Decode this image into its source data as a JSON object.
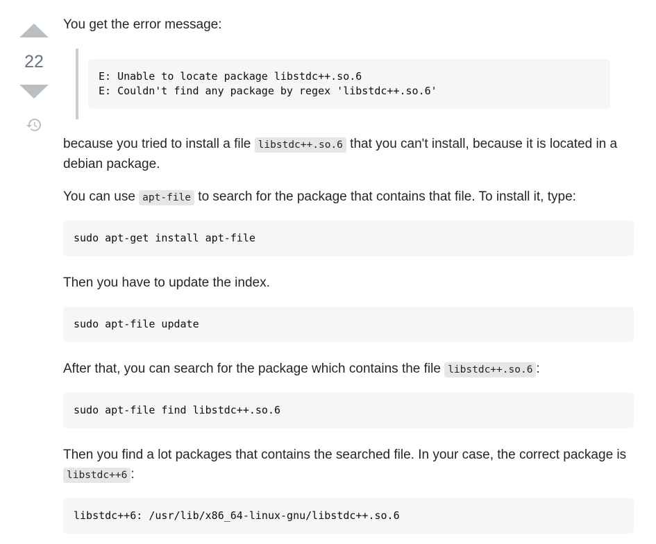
{
  "vote": {
    "count": "22"
  },
  "intro": "You get the error message:",
  "error_block": {
    "line1": "E: Unable to locate package libstdc++.so.6",
    "line2": "E: Couldn't find any package by regex 'libstdc++.so.6'"
  },
  "para1": {
    "before": "because you tried to install a file ",
    "code": "libstdc++.so.6",
    "after": " that you can't install, because it is located in a debian package."
  },
  "para2": {
    "before": "You can use ",
    "code": "apt-file",
    "after": " to search for the package that contains that file. To install it, type:"
  },
  "code1": "sudo apt-get install apt-file",
  "para3": "Then you have to update the index.",
  "code2": "sudo apt-file update",
  "para4": {
    "before": "After that, you can search for the package which contains the file ",
    "code": "libstdc++.so.6",
    "after": ":"
  },
  "code3": "sudo apt-file find libstdc++.so.6",
  "para5": {
    "before": "Then you find a lot packages that contains the searched file. In your case, the correct package is ",
    "code": "libstdc++6",
    "after": ":"
  },
  "code4": "libstdc++6: /usr/lib/x86_64-linux-gnu/libstdc++.so.6",
  "icons": {
    "upvote": "upvote-arrow-icon",
    "downvote": "downvote-arrow-icon",
    "history": "history-icon"
  }
}
